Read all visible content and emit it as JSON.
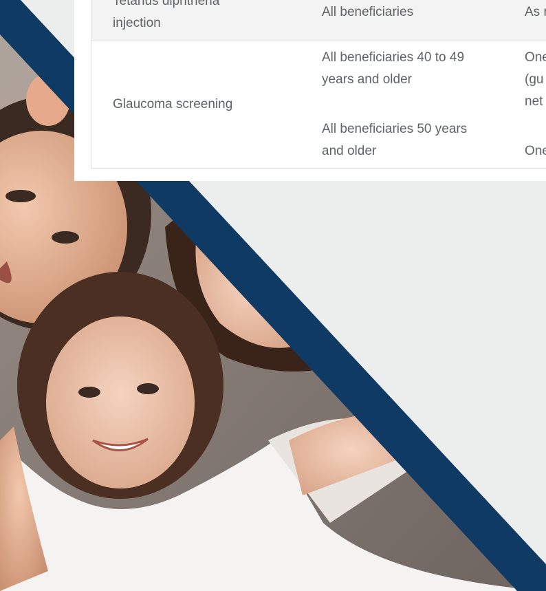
{
  "table": {
    "rows": [
      {
        "service": [
          "Tetanus diphtheria",
          "injection"
        ],
        "eligible": [
          "All beneficiaries"
        ],
        "frequency": [
          "As r"
        ]
      },
      {
        "service": [
          "Glaucoma screening"
        ],
        "eligible_groups": [
          [
            "All beneficiaries 40 to 49",
            "years and older"
          ],
          [
            "All beneficiaries 50 years",
            "and older"
          ]
        ],
        "frequency": [
          "One",
          "(gu",
          "net",
          "One"
        ]
      }
    ]
  },
  "colors": {
    "diagonal_band": "#0f3a63",
    "page_background": "#eceeee",
    "table_header_row": "#f3f3f3",
    "text": "#5f6366"
  },
  "hero_image": {
    "subject": "family-photo"
  }
}
